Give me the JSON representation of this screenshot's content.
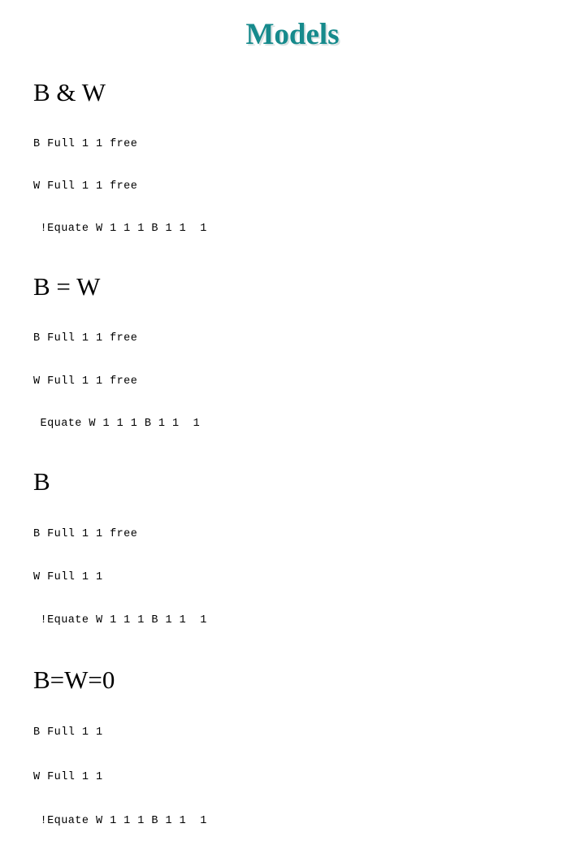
{
  "slide": {
    "title": "Models",
    "title_color": "#168a8c",
    "background_color": "#ffffff",
    "text_color": "#000000"
  },
  "sections": [
    {
      "heading": "B & W",
      "lines": [
        "B Full 1 1 free",
        "W Full 1 1 free",
        " !Equate W 1 1 1 B 1 1  1"
      ]
    },
    {
      "heading": "B = W",
      "lines": [
        "B Full 1 1 free",
        "W Full 1 1 free",
        " Equate W 1 1 1 B 1 1  1"
      ]
    },
    {
      "heading": "B",
      "lines": [
        "B Full 1 1 free",
        "W Full 1 1",
        " !Equate W 1 1 1 B 1 1  1"
      ]
    },
    {
      "heading": "B=W=0",
      "lines": [
        "B Full 1 1",
        "W Full 1 1",
        " !Equate W 1 1 1 B 1 1  1"
      ]
    }
  ]
}
